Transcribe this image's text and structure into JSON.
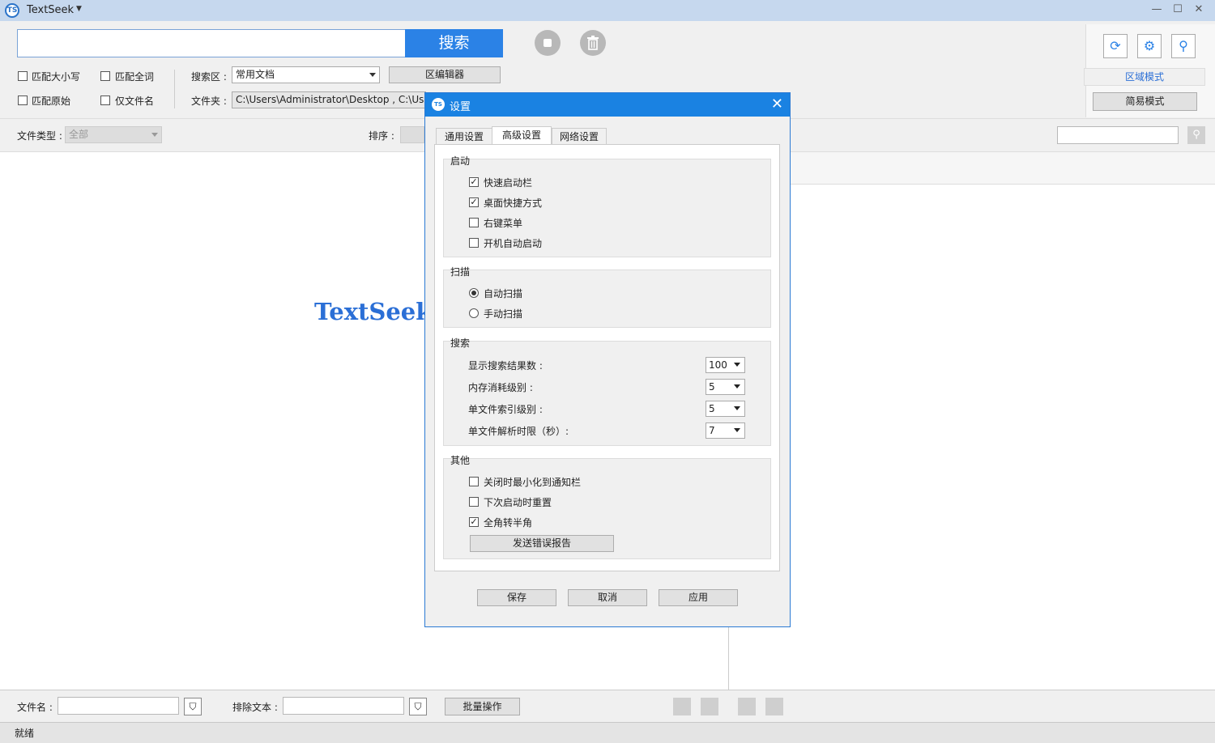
{
  "app": {
    "title": "TextSeek",
    "logo_text": "TS",
    "brand_text": "TextSeek",
    "status": "就绪"
  },
  "window": {
    "minimize": "—",
    "maximize": "☐",
    "close": "✕"
  },
  "search": {
    "value": "",
    "button_label": "搜索"
  },
  "options": {
    "match_case": {
      "label": "匹配大小写",
      "checked": false
    },
    "match_whole": {
      "label": "匹配全词",
      "checked": false
    },
    "match_original": {
      "label": "匹配原始",
      "checked": false
    },
    "filename_only": {
      "label": "仅文件名",
      "checked": false
    }
  },
  "search_area": {
    "label": "搜索区 :",
    "selected": "常用文档",
    "editor_button": "区编辑器"
  },
  "folder": {
    "label": "文件夹 :",
    "value": "C:\\Users\\Administrator\\Desktop , C:\\Users\\"
  },
  "modes": {
    "region": "区域模式",
    "simple": "简易模式"
  },
  "tools": {
    "refresh": "⟳",
    "settings": "⚙",
    "find": "⚲"
  },
  "filter": {
    "filetype_label": "文件类型 :",
    "filetype_value": "全部",
    "sort_label": "排序 :",
    "search_icon": "⚲"
  },
  "bottom": {
    "filename_label": "文件名 :",
    "exclude_label": "排除文本 :",
    "batch_button": "批量操作",
    "filter_icon": "⛉"
  },
  "dialog": {
    "title": "设置",
    "logo_text": "TS",
    "close": "✕",
    "tabs": [
      "通用设置",
      "高级设置",
      "网络设置"
    ],
    "startup": {
      "title": "启动",
      "items": [
        {
          "label": "快速启动栏",
          "checked": true
        },
        {
          "label": "桌面快捷方式",
          "checked": true
        },
        {
          "label": "右键菜单",
          "checked": false
        },
        {
          "label": "开机自动启动",
          "checked": false
        }
      ]
    },
    "scan": {
      "title": "扫描",
      "items": [
        {
          "label": "自动扫描",
          "selected": true
        },
        {
          "label": "手动扫描",
          "selected": false
        }
      ]
    },
    "search": {
      "title": "搜索",
      "rows": [
        {
          "label": "显示搜索结果数 :",
          "value": "100"
        },
        {
          "label": "内存消耗级别 :",
          "value": "5"
        },
        {
          "label": "单文件索引级别 :",
          "value": "5"
        },
        {
          "label": "单文件解析时限（秒）:",
          "value": "7"
        }
      ]
    },
    "other": {
      "title": "其他",
      "items": [
        {
          "label": "关闭时最小化到通知栏",
          "checked": false
        },
        {
          "label": "下次启动时重置",
          "checked": false
        },
        {
          "label": "全角转半角",
          "checked": true
        }
      ],
      "report_button": "发送错误报告"
    },
    "buttons": {
      "save": "保存",
      "cancel": "取消",
      "apply": "应用"
    }
  }
}
